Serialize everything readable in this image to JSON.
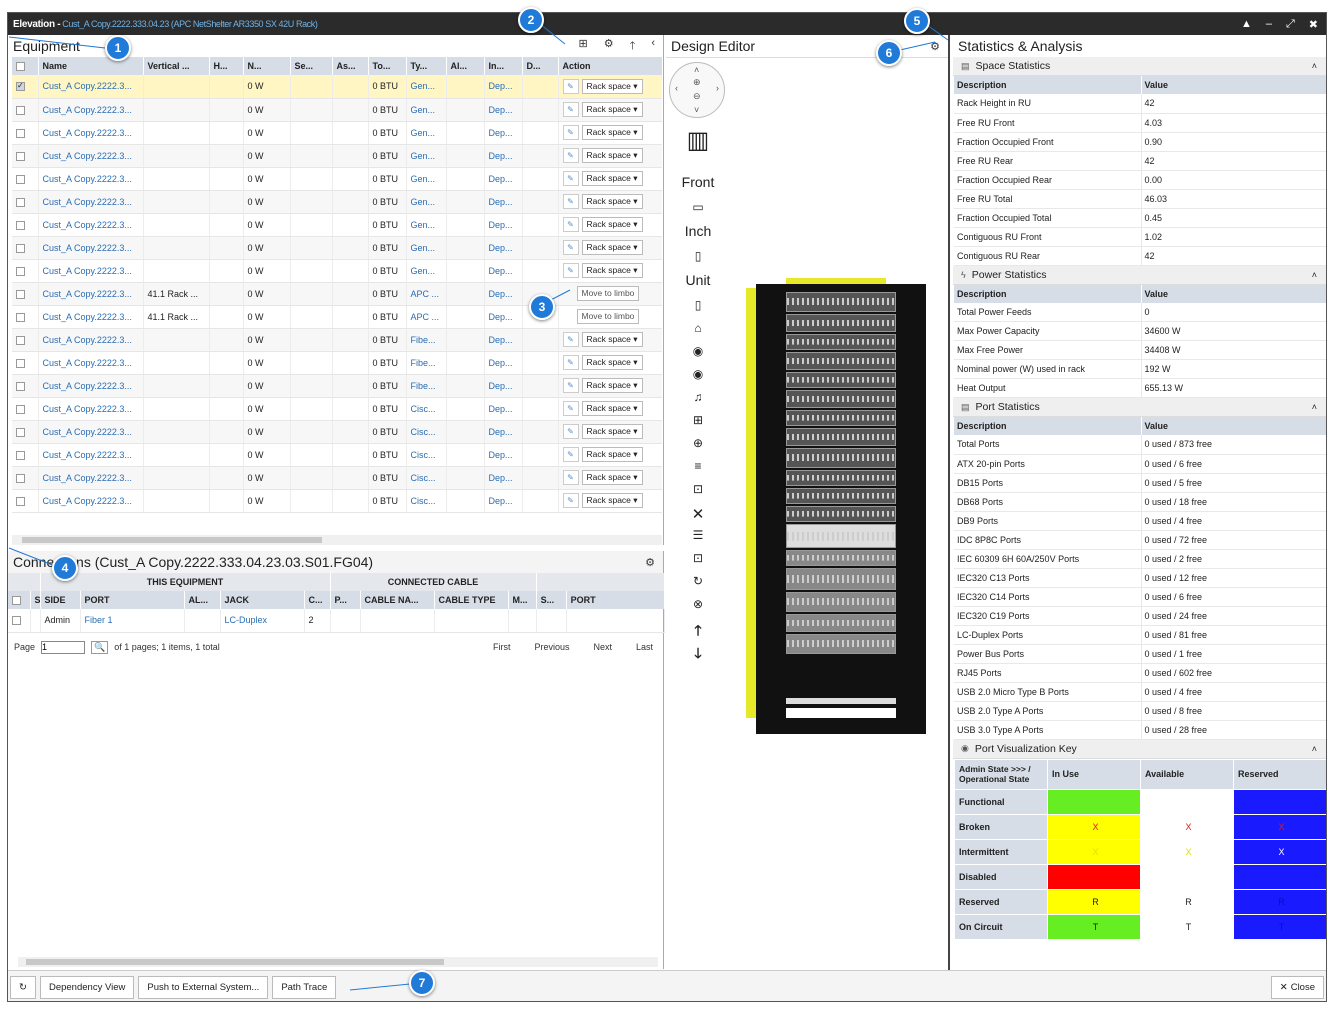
{
  "title": {
    "label": "Elevation - ",
    "context": "Cust_A Copy.2222.333.04.23 (APC NetShelter AR3350 SX 42U Rack)"
  },
  "equipment": {
    "title": "Equipment",
    "columns": [
      "",
      "Name",
      "Vertical ...",
      "H...",
      "N...",
      "Se...",
      "As...",
      "To...",
      "Ty...",
      "Al...",
      "In...",
      "D...",
      "Action"
    ],
    "rows": [
      {
        "name": "Cust_A Copy.2222.3...",
        "vertical": "",
        "power": "0 W",
        "btu": "0 BTU",
        "type": "Gen...",
        "in": "Dep...",
        "action": "Rack space",
        "checked": true
      },
      {
        "name": "Cust_A Copy.2222.3...",
        "vertical": "",
        "power": "0 W",
        "btu": "0 BTU",
        "type": "Gen...",
        "in": "Dep...",
        "action": "Rack space"
      },
      {
        "name": "Cust_A Copy.2222.3...",
        "vertical": "",
        "power": "0 W",
        "btu": "0 BTU",
        "type": "Gen...",
        "in": "Dep...",
        "action": "Rack space"
      },
      {
        "name": "Cust_A Copy.2222.3...",
        "vertical": "",
        "power": "0 W",
        "btu": "0 BTU",
        "type": "Gen...",
        "in": "Dep...",
        "action": "Rack space"
      },
      {
        "name": "Cust_A Copy.2222.3...",
        "vertical": "",
        "power": "0 W",
        "btu": "0 BTU",
        "type": "Gen...",
        "in": "Dep...",
        "action": "Rack space"
      },
      {
        "name": "Cust_A Copy.2222.3...",
        "vertical": "",
        "power": "0 W",
        "btu": "0 BTU",
        "type": "Gen...",
        "in": "Dep...",
        "action": "Rack space"
      },
      {
        "name": "Cust_A Copy.2222.3...",
        "vertical": "",
        "power": "0 W",
        "btu": "0 BTU",
        "type": "Gen...",
        "in": "Dep...",
        "action": "Rack space"
      },
      {
        "name": "Cust_A Copy.2222.3...",
        "vertical": "",
        "power": "0 W",
        "btu": "0 BTU",
        "type": "Gen...",
        "in": "Dep...",
        "action": "Rack space"
      },
      {
        "name": "Cust_A Copy.2222.3...",
        "vertical": "",
        "power": "0 W",
        "btu": "0 BTU",
        "type": "Gen...",
        "in": "Dep...",
        "action": "Rack space"
      },
      {
        "name": "Cust_A Copy.2222.3...",
        "vertical": "41.1 Rack ...",
        "power": "0 W",
        "btu": "0 BTU",
        "type": "APC ...",
        "in": "Dep...",
        "action": "Move to limbo",
        "limbo": true
      },
      {
        "name": "Cust_A Copy.2222.3...",
        "vertical": "41.1 Rack ...",
        "power": "0 W",
        "btu": "0 BTU",
        "type": "APC ...",
        "in": "Dep...",
        "action": "Move to limbo",
        "limbo": true
      },
      {
        "name": "Cust_A Copy.2222.3...",
        "vertical": "",
        "power": "0 W",
        "btu": "0 BTU",
        "type": "Fibe...",
        "in": "Dep...",
        "action": "Rack space"
      },
      {
        "name": "Cust_A Copy.2222.3...",
        "vertical": "",
        "power": "0 W",
        "btu": "0 BTU",
        "type": "Fibe...",
        "in": "Dep...",
        "action": "Rack space"
      },
      {
        "name": "Cust_A Copy.2222.3...",
        "vertical": "",
        "power": "0 W",
        "btu": "0 BTU",
        "type": "Fibe...",
        "in": "Dep...",
        "action": "Rack space"
      },
      {
        "name": "Cust_A Copy.2222.3...",
        "vertical": "",
        "power": "0 W",
        "btu": "0 BTU",
        "type": "Cisc...",
        "in": "Dep...",
        "action": "Rack space"
      },
      {
        "name": "Cust_A Copy.2222.3...",
        "vertical": "",
        "power": "0 W",
        "btu": "0 BTU",
        "type": "Cisc...",
        "in": "Dep...",
        "action": "Rack space"
      },
      {
        "name": "Cust_A Copy.2222.3...",
        "vertical": "",
        "power": "0 W",
        "btu": "0 BTU",
        "type": "Cisc...",
        "in": "Dep...",
        "action": "Rack space"
      },
      {
        "name": "Cust_A Copy.2222.3...",
        "vertical": "",
        "power": "0 W",
        "btu": "0 BTU",
        "type": "Cisc...",
        "in": "Dep...",
        "action": "Rack space"
      },
      {
        "name": "Cust_A Copy.2222.3...",
        "vertical": "",
        "power": "0 W",
        "btu": "0 BTU",
        "type": "Cisc...",
        "in": "Dep...",
        "action": "Rack space"
      }
    ]
  },
  "connections": {
    "title": "Connections (Cust_A Copy.2222.333.04.23.03.S01.FG04)",
    "group_this": "THIS EQUIPMENT",
    "group_cable": "CONNECTED CABLE",
    "columns": [
      "",
      "S",
      "SIDE",
      "PORT",
      "AL...",
      "JACK",
      "C...",
      "P...",
      "CABLE NA...",
      "CABLE TYPE",
      "M...",
      "S...",
      "PORT"
    ],
    "row": {
      "side": "Admin",
      "port": "Fiber 1",
      "jack": "LC-Duplex",
      "c": "2"
    },
    "pager": {
      "page_label": "Page",
      "page_value": "1",
      "of_text": "of 1 pages; 1 items, 1 total",
      "first": "First",
      "previous": "Previous",
      "next": "Next",
      "last": "Last"
    }
  },
  "design": {
    "title": "Design Editor",
    "front": "Front",
    "inch": "Inch",
    "unit": "Unit"
  },
  "stats": {
    "title": "Statistics & Analysis",
    "desc_h": "Description",
    "val_h": "Value",
    "space": {
      "title": "Space Statistics",
      "rows": [
        [
          "Rack Height in RU",
          "42"
        ],
        [
          "Free RU Front",
          "4.03"
        ],
        [
          "Fraction Occupied Front",
          "0.90"
        ],
        [
          "Free RU Rear",
          "42"
        ],
        [
          "Fraction Occupied Rear",
          "0.00"
        ],
        [
          "Free RU Total",
          "46.03"
        ],
        [
          "Fraction Occupied Total",
          "0.45"
        ],
        [
          "Contiguous RU Front",
          "1.02"
        ],
        [
          "Contiguous RU Rear",
          "42"
        ]
      ]
    },
    "power": {
      "title": "Power Statistics",
      "rows": [
        [
          "Total Power Feeds",
          "0"
        ],
        [
          "Max Power Capacity",
          "34600 W"
        ],
        [
          "Max Free Power",
          "34408 W"
        ],
        [
          "Nominal power (W) used in rack",
          "192 W"
        ],
        [
          "Heat Output",
          "655.13 W"
        ]
      ]
    },
    "port": {
      "title": "Port Statistics",
      "rows": [
        [
          "Total Ports",
          "0 used / 873 free"
        ],
        [
          "ATX 20-pin Ports",
          "0 used / 6 free"
        ],
        [
          "DB15 Ports",
          "0 used / 5 free"
        ],
        [
          "DB68 Ports",
          "0 used / 18 free"
        ],
        [
          "DB9 Ports",
          "0 used / 4 free"
        ],
        [
          "IDC 8P8C Ports",
          "0 used / 72 free"
        ],
        [
          "IEC 60309 6H 60A/250V Ports",
          "0 used / 2 free"
        ],
        [
          "IEC320 C13 Ports",
          "0 used / 12 free"
        ],
        [
          "IEC320 C14 Ports",
          "0 used / 6 free"
        ],
        [
          "IEC320 C19 Ports",
          "0 used / 24 free"
        ],
        [
          "LC-Duplex Ports",
          "0 used / 81 free"
        ],
        [
          "Power Bus Ports",
          "0 used / 1 free"
        ],
        [
          "RJ45 Ports",
          "0 used / 602 free"
        ],
        [
          "USB 2.0 Micro Type B Ports",
          "0 used / 4 free"
        ],
        [
          "USB 2.0 Type A Ports",
          "0 used / 8 free"
        ],
        [
          "USB 3.0 Type A Ports",
          "0 used / 28 free"
        ]
      ]
    },
    "viz": {
      "title": "Port Visualization Key",
      "corner": "Admin State >>> / Operational State",
      "cols": [
        "In Use",
        "Available",
        "Reserved"
      ],
      "rows": [
        {
          "label": "Functional",
          "cells": [
            {
              "bg": "#66ee22",
              "t": ""
            },
            {
              "bg": "#ffffff",
              "t": ""
            },
            {
              "bg": "#1a1aff",
              "t": ""
            }
          ]
        },
        {
          "label": "Broken",
          "cells": [
            {
              "bg": "#ffff00",
              "t": "X",
              "c": "#e01818"
            },
            {
              "bg": "#ffffff",
              "t": "X",
              "c": "#e01818"
            },
            {
              "bg": "#1a1aff",
              "t": "X",
              "c": "#e01818"
            }
          ]
        },
        {
          "label": "Intermittent",
          "cells": [
            {
              "bg": "#ffff00",
              "t": "X",
              "c": "#e0e000"
            },
            {
              "bg": "#ffffff",
              "t": "X",
              "c": "#e0e000"
            },
            {
              "bg": "#1a1aff",
              "t": "X",
              "c": "#ffffff"
            }
          ]
        },
        {
          "label": "Disabled",
          "cells": [
            {
              "bg": "#ff0000",
              "t": ""
            },
            {
              "bg": "#ffffff",
              "t": ""
            },
            {
              "bg": "#1a1aff",
              "t": ""
            }
          ]
        },
        {
          "label": "Reserved",
          "cells": [
            {
              "bg": "#ffff00",
              "t": "R",
              "c": "#222"
            },
            {
              "bg": "#ffffff",
              "t": "R",
              "c": "#222"
            },
            {
              "bg": "#1a1aff",
              "t": "R",
              "c": "#1010aa"
            }
          ]
        },
        {
          "label": "On Circuit",
          "cells": [
            {
              "bg": "#66ee22",
              "t": "T",
              "c": "#222"
            },
            {
              "bg": "#ffffff",
              "t": "T",
              "c": "#222"
            },
            {
              "bg": "#1a1aff",
              "t": "T",
              "c": "#1010aa"
            }
          ]
        }
      ]
    }
  },
  "footer": {
    "dependency": "Dependency View",
    "push": "Push to External System...",
    "trace": "Path Trace",
    "close": "Close"
  },
  "callouts": [
    "1",
    "2",
    "3",
    "4",
    "5",
    "6",
    "7"
  ]
}
